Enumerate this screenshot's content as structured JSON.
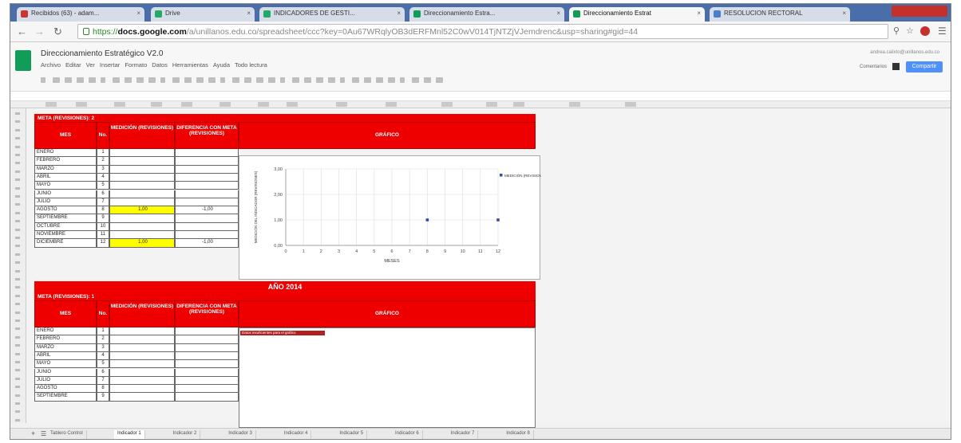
{
  "browser": {
    "tabs": [
      {
        "label": "Recibidos (63) - adam...",
        "fav": "#c33"
      },
      {
        "label": "Drive",
        "fav": "#2a6"
      },
      {
        "label": "INDICADORES DE GESTI...",
        "fav": "#2a6"
      },
      {
        "label": "Direccionamiento Estra...",
        "fav": "#0f9d58"
      },
      {
        "label": "Direccionamiento Estrat",
        "fav": "#0f9d58"
      },
      {
        "label": "RESOLUCION RECTORAL",
        "fav": "#4a7ec9"
      }
    ],
    "url_scheme": "https://",
    "url_host": "docs.google.com",
    "url_path": "/a/unillanos.edu.co/spreadsheet/ccc?key=0Au67WRqlyOB3dERFMnl52C0wV014TjNTZjVJemdrenc&usp=sharing#gid=44"
  },
  "docs": {
    "title": "Direccionamiento Estratégico V2.0",
    "menu": [
      "Archivo",
      "Editar",
      "Ver",
      "Insertar",
      "Formato",
      "Datos",
      "Herramientas",
      "Ayuda",
      "Todo lectura"
    ],
    "account": "andrea.calixto@unillanos.edu.co",
    "comments_label": "Comentarios",
    "share_label": "Compartir"
  },
  "section1": {
    "meta": "META (REVISIONES): 2",
    "headers": [
      "MES",
      "No.",
      "MEDICIÓN (REVISIONES)",
      "DIFERENCIA CON META (REVISIONES)",
      "GRÁFICO"
    ],
    "rows": [
      {
        "mes": "ENERO",
        "no": "1",
        "med": "",
        "dif": ""
      },
      {
        "mes": "FEBRERO",
        "no": "2",
        "med": "",
        "dif": ""
      },
      {
        "mes": "MARZO",
        "no": "3",
        "med": "",
        "dif": ""
      },
      {
        "mes": "ABRIL",
        "no": "4",
        "med": "",
        "dif": ""
      },
      {
        "mes": "MAYO",
        "no": "5",
        "med": "",
        "dif": ""
      },
      {
        "mes": "JUNIO",
        "no": "6",
        "med": "",
        "dif": ""
      },
      {
        "mes": "JULIO",
        "no": "7",
        "med": "",
        "dif": ""
      },
      {
        "mes": "AGOSTO",
        "no": "8",
        "med": "1,00",
        "dif": "-1,00"
      },
      {
        "mes": "SEPTIEMBRE",
        "no": "9",
        "med": "",
        "dif": ""
      },
      {
        "mes": "OCTUBRE",
        "no": "10",
        "med": "",
        "dif": ""
      },
      {
        "mes": "NOVIEMBRE",
        "no": "11",
        "med": "",
        "dif": ""
      },
      {
        "mes": "DICIEMBRE",
        "no": "12",
        "med": "1,00",
        "dif": "-1,00"
      }
    ]
  },
  "section2": {
    "year": "AÑO 2014",
    "meta": "META (REVISIONES): 1",
    "headers": [
      "MES",
      "No.",
      "MEDICIÓN (REVISIONES)",
      "DIFERENCIA CON META (REVISIONES)",
      "GRÁFICO"
    ],
    "rows": [
      {
        "mes": "ENERO",
        "no": "1"
      },
      {
        "mes": "FEBRERO",
        "no": "2"
      },
      {
        "mes": "MARZO",
        "no": "3"
      },
      {
        "mes": "ABRIL",
        "no": "4"
      },
      {
        "mes": "MAYO",
        "no": "5"
      },
      {
        "mes": "JUNIO",
        "no": "6"
      },
      {
        "mes": "JULIO",
        "no": "7"
      },
      {
        "mes": "AGOSTO",
        "no": "8"
      },
      {
        "mes": "SEPTIEMBRE",
        "no": "9"
      }
    ],
    "chart_error": "Datos insuficientes para el gráfico"
  },
  "sheet_tabs": [
    "Tablero Control",
    "Indicador 1",
    "Indicador 2",
    "Indicador 3",
    "Indicador 4",
    "Indicador 5",
    "Indicador 6",
    "Indicador 7",
    "Indicador 8"
  ],
  "active_sheet": 1,
  "chart_data": {
    "type": "scatter",
    "title": "",
    "xlabel": "MESES",
    "ylabel": "MEDICIÓN DEL INDICADOR (REVISIONES)",
    "legend": [
      "MEDICIÓN (REVISIONES)"
    ],
    "legend_position": "right",
    "x_ticks": [
      0,
      1,
      2,
      3,
      4,
      5,
      6,
      7,
      8,
      9,
      10,
      11,
      12
    ],
    "y_ticks": [
      "0,00",
      "1,00",
      "2,00",
      "3,00"
    ],
    "xlim": [
      0,
      12
    ],
    "ylim": [
      0,
      3
    ],
    "grid": true,
    "series": [
      {
        "name": "MEDICIÓN (REVISIONES)",
        "color": "#3949ab",
        "points": [
          [
            8,
            1.0
          ],
          [
            12,
            1.0
          ]
        ]
      }
    ]
  }
}
